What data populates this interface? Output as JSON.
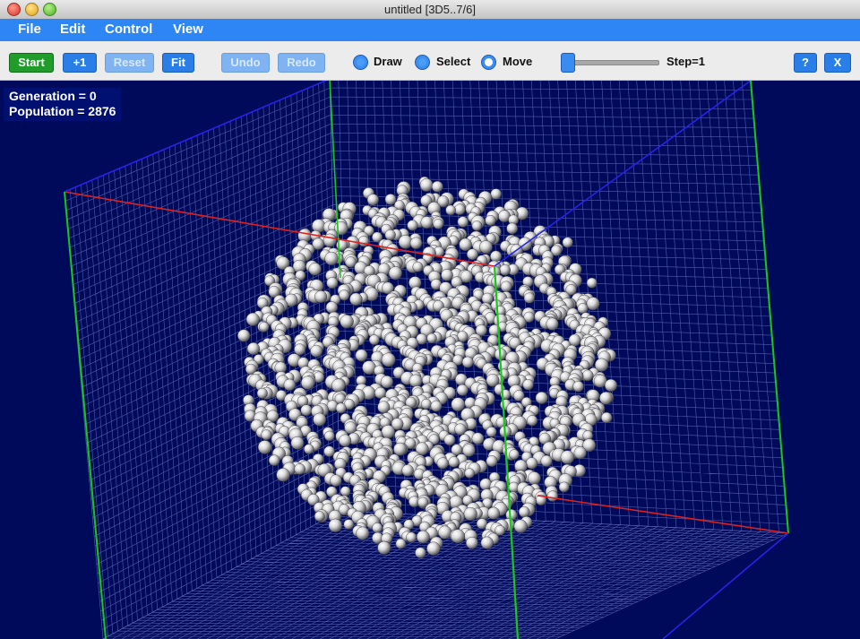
{
  "window": {
    "title": "untitled [3D5..7/6]"
  },
  "menu": {
    "file": "File",
    "edit": "Edit",
    "control": "Control",
    "view": "View"
  },
  "toolbar": {
    "start": "Start",
    "step_one": "+1",
    "reset": "Reset",
    "fit": "Fit",
    "undo": "Undo",
    "redo": "Redo",
    "draw": "Draw",
    "select": "Select",
    "move": "Move",
    "step_label": "Step=1",
    "help": "?",
    "close": "X",
    "mode_selected": "Move",
    "slider_value": 1
  },
  "status": {
    "generation": "Generation = 0",
    "population": "Population = 2876"
  },
  "colors": {
    "background": "#000a5a",
    "menubar": "#2d86f4",
    "grid": "#6e78c8",
    "axis_red": "#e02020",
    "axis_green": "#18c818",
    "axis_blue": "#2424e8",
    "cell": "#d8d8d8"
  }
}
